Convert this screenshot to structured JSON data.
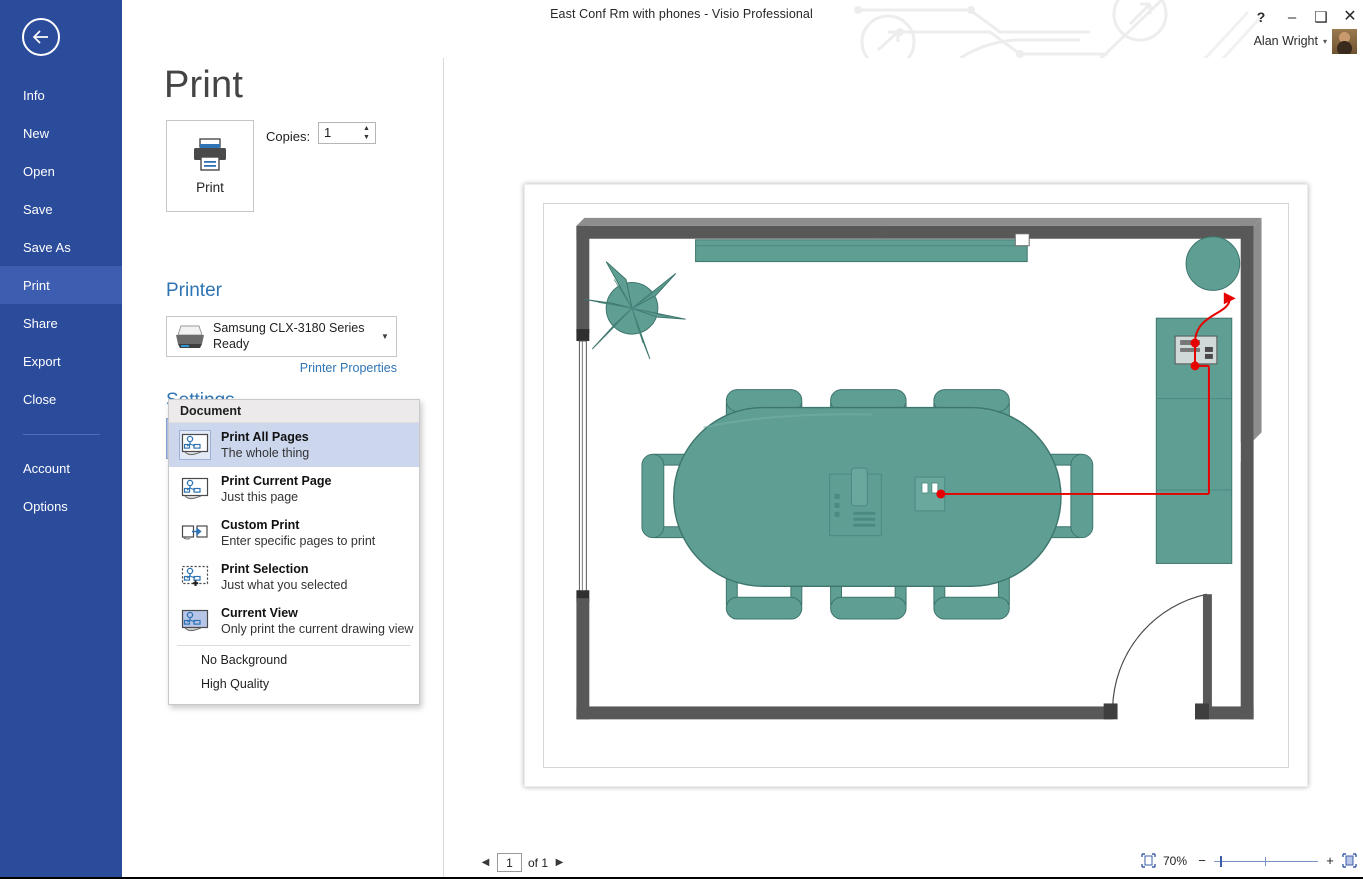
{
  "window": {
    "title": "East Conf Rm with phones - Visio Professional",
    "help_label": "?",
    "minimize_label": "–",
    "maximize_label": "❑",
    "close_label": "✕",
    "account_name": "Alan Wright",
    "account_caret": "▾"
  },
  "sidebar": {
    "back_label": "←",
    "items": [
      {
        "label": "Info",
        "selected": false
      },
      {
        "label": "New",
        "selected": false
      },
      {
        "label": "Open",
        "selected": false
      },
      {
        "label": "Save",
        "selected": false
      },
      {
        "label": "Save As",
        "selected": false
      },
      {
        "label": "Print",
        "selected": true
      },
      {
        "label": "Share",
        "selected": false
      },
      {
        "label": "Export",
        "selected": false
      },
      {
        "label": "Close",
        "selected": false
      }
    ],
    "items_after_divider": [
      {
        "label": "Account",
        "selected": false
      },
      {
        "label": "Options",
        "selected": false
      }
    ]
  },
  "page": {
    "title": "Print"
  },
  "print_button": {
    "label": "Print"
  },
  "copies": {
    "label": "Copies:",
    "value": "1",
    "spin_up": "▲",
    "spin_down": "▼"
  },
  "printer": {
    "heading": "Printer",
    "info_icon": "i",
    "name": "Samsung CLX-3180 Series",
    "status": "Ready",
    "caret": "▼",
    "properties_link": "Printer Properties"
  },
  "settings": {
    "heading": "Settings",
    "selected_title": "Print All Pages",
    "selected_sub": "The whole thing",
    "caret": "▼"
  },
  "dropdown": {
    "group_header": "Document",
    "items": [
      {
        "title": "Print All Pages",
        "sub": "The whole thing",
        "icon": "print-all-pages-icon",
        "active": true
      },
      {
        "title": "Print Current Page",
        "sub": "Just this page",
        "icon": "print-current-page-icon",
        "active": false
      },
      {
        "title": "Custom Print",
        "sub": "Enter specific pages to print",
        "icon": "custom-print-icon",
        "active": false
      },
      {
        "title": "Print Selection",
        "sub": "Just what you selected",
        "icon": "print-selection-icon",
        "active": false
      },
      {
        "title": "Current View",
        "sub": "Only print the current drawing view",
        "icon": "current-view-icon",
        "active": false
      }
    ],
    "toggles": [
      {
        "label": "No Background"
      },
      {
        "label": "High Quality"
      }
    ]
  },
  "statusbar": {
    "prev_label": "◀",
    "next_label": "▶",
    "page_value": "1",
    "page_of": "of 1",
    "zoom_percent": "70%",
    "zoom_minus": "−",
    "zoom_plus": "+"
  },
  "colors": {
    "nav_blue": "#2b4b9b",
    "nav_selected_blue": "#3c5db0",
    "accent_link": "#2e74b5",
    "settings_highlight": "#b7c5e8",
    "dropdown_active": "#ccd7ee",
    "floorplan_furniture": "#5f9e93",
    "floorplan_wall": "#585858",
    "cable_red": "#e60000"
  },
  "preview": {
    "drawing_name": "East Conf Rm with phones",
    "shapes": [
      "conference-table-oval",
      "chairs-x8",
      "plant",
      "whiteboard",
      "cabinet",
      "conference-phone",
      "wall-jack",
      "door",
      "windows-x2",
      "red-cable-connector"
    ]
  }
}
